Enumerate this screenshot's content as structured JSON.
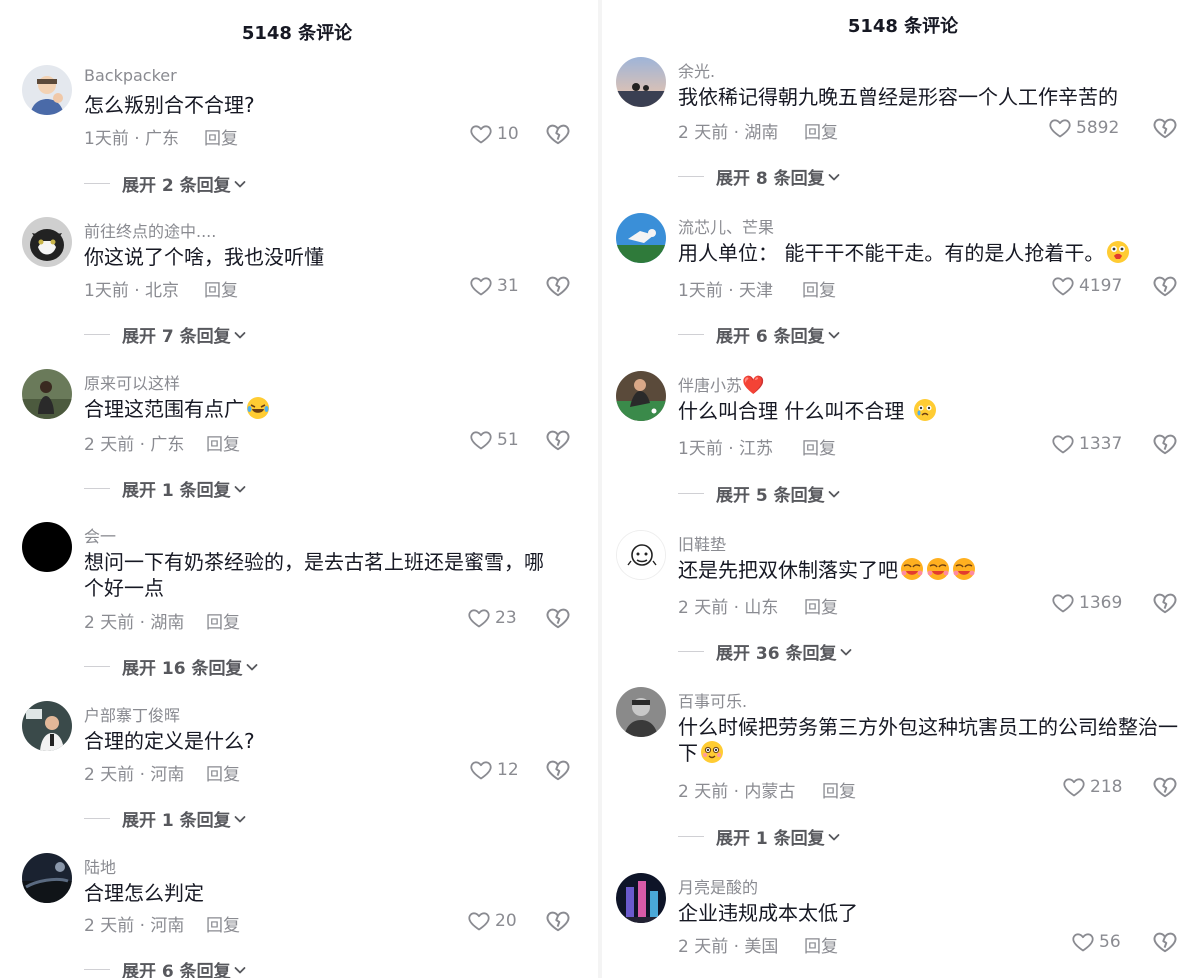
{
  "left": {
    "title": "5148 条评论",
    "comments": [
      {
        "username": "Backpacker",
        "text": "怎么叛别合不合理?",
        "meta": "1天前 · 广东",
        "reply": "回复",
        "likes": "10",
        "expand": "展开 2 条回复"
      },
      {
        "username": "前往终点的途中....",
        "text": "你这说了个啥，我也没听懂",
        "meta": "1天前 · 北京",
        "reply": "回复",
        "likes": "31",
        "expand": "展开 7 条回复"
      },
      {
        "username": "原来可以这样",
        "text": "合理这范围有点广",
        "emoji": "laugh-cry-emoji",
        "meta": "2 天前 · 广东",
        "reply": "回复",
        "likes": "51",
        "expand": "展开 1 条回复"
      },
      {
        "username": "会一",
        "text": "想问一下有奶茶经验的，是去古茗上班还是蜜雪，哪个好一点",
        "meta": "2 天前 · 湖南",
        "reply": "回复",
        "likes": "23",
        "expand": "展开 16 条回复"
      },
      {
        "username": "户部寨丁俊晖",
        "text": "合理的定义是什么?",
        "meta": "2 天前 · 河南",
        "reply": "回复",
        "likes": "12",
        "expand": "展开 1 条回复"
      },
      {
        "username": "陆地",
        "text": "合理怎么判定",
        "meta": "2 天前 · 河南",
        "reply": "回复",
        "likes": "20",
        "expand": "展开 6 条回复"
      }
    ]
  },
  "right": {
    "title": "5148 条评论",
    "comments": [
      {
        "username": "余光.",
        "text": "我依稀记得朝九晚五曾经是形容一个人工作辛苦的",
        "meta": "2 天前 · 湖南",
        "reply": "回复",
        "likes": "5892",
        "expand": "展开 8 条回复"
      },
      {
        "username": "流芯儿、芒果",
        "text": "用人单位：  能干干不能干走。有的是人抢着干。",
        "emoji": "shocked-emoji",
        "meta": "1天前 · 天津",
        "reply": "回复",
        "likes": "4197",
        "expand": "展开 6 条回复"
      },
      {
        "username": "伴唐小苏",
        "username_heart": "❤️",
        "text": "什么叫合理 什么叫不合理",
        "emoji": "crying-emoji",
        "meta": "1天前 · 江苏",
        "reply": "回复",
        "likes": "1337",
        "expand": "展开 5 条回复"
      },
      {
        "username": "旧鞋垫",
        "text": "还是先把双休制落实了吧",
        "emoji": "angry-emoji",
        "emoji_count": 3,
        "meta": "2 天前 · 山东",
        "reply": "回复",
        "likes": "1369",
        "expand": "展开 36 条回复"
      },
      {
        "username": "百事可乐.",
        "text": "什么时候把劳务第三方外包这种坑害员工的公司给整治一下",
        "emoji": "blush-emoji",
        "meta": "2 天前 · 内蒙古",
        "reply": "回复",
        "likes": "218",
        "expand": "展开 1 条回复"
      },
      {
        "username": "月亮是酸的",
        "text": "企业违规成本太低了",
        "meta": "2 天前 · 美国",
        "reply": "回复",
        "likes": "56"
      }
    ]
  }
}
